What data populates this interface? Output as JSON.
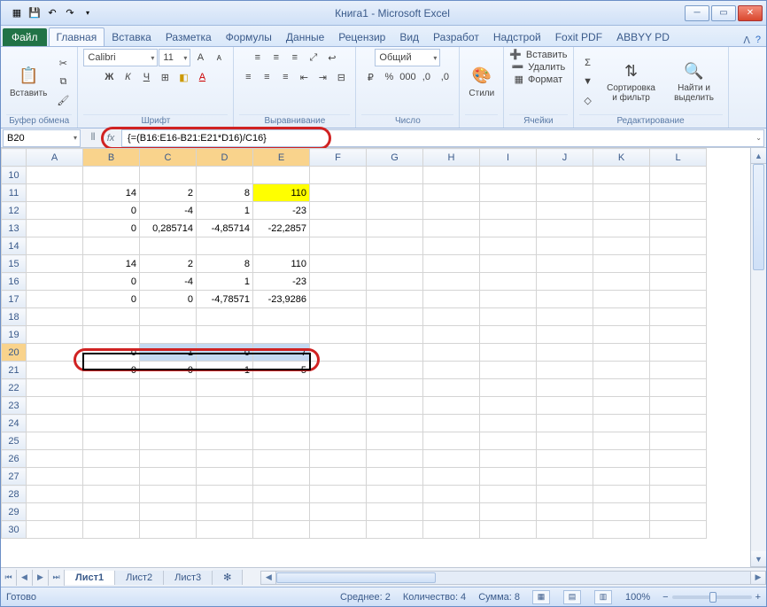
{
  "title": "Книга1 - Microsoft Excel",
  "tabs": {
    "file": "Файл",
    "items": [
      "Главная",
      "Вставка",
      "Разметка",
      "Формулы",
      "Данные",
      "Рецензир",
      "Вид",
      "Разработ",
      "Надстрой",
      "Foxit PDF",
      "ABBYY PD"
    ],
    "active": 0
  },
  "ribbon": {
    "clipboard": {
      "paste": "Вставить",
      "label": "Буфер обмена"
    },
    "font": {
      "name": "Calibri",
      "size": "11",
      "label": "Шрифт"
    },
    "align": {
      "label": "Выравнивание"
    },
    "number": {
      "format": "Общий",
      "label": "Число"
    },
    "styles": {
      "btn": "Стили"
    },
    "cells": {
      "insert": "Вставить",
      "delete": "Удалить",
      "format": "Формат",
      "label": "Ячейки"
    },
    "editing": {
      "sort": "Сортировка и фильтр",
      "find": "Найти и выделить",
      "label": "Редактирование"
    }
  },
  "namebox": "B20",
  "formula": "{=(B16:E16-B21:E21*D16)/C16}",
  "columns": [
    "A",
    "B",
    "C",
    "D",
    "E",
    "F",
    "G",
    "H",
    "I",
    "J",
    "K",
    "L"
  ],
  "rows": [
    {
      "r": 10,
      "c": [
        "",
        "",
        "",
        "",
        "",
        "",
        "",
        "",
        "",
        "",
        "",
        ""
      ]
    },
    {
      "r": 11,
      "c": [
        "",
        "14",
        "2",
        "8",
        "110",
        "",
        "",
        "",
        "",
        "",
        "",
        ""
      ]
    },
    {
      "r": 12,
      "c": [
        "",
        "0",
        "-4",
        "1",
        "-23",
        "",
        "",
        "",
        "",
        "",
        "",
        ""
      ]
    },
    {
      "r": 13,
      "c": [
        "",
        "0",
        "0,285714",
        "-4,85714",
        "-22,2857",
        "",
        "",
        "",
        "",
        "",
        "",
        ""
      ]
    },
    {
      "r": 14,
      "c": [
        "",
        "",
        "",
        "",
        "",
        "",
        "",
        "",
        "",
        "",
        "",
        ""
      ]
    },
    {
      "r": 15,
      "c": [
        "",
        "14",
        "2",
        "8",
        "110",
        "",
        "",
        "",
        "",
        "",
        "",
        ""
      ]
    },
    {
      "r": 16,
      "c": [
        "",
        "0",
        "-4",
        "1",
        "-23",
        "",
        "",
        "",
        "",
        "",
        "",
        ""
      ]
    },
    {
      "r": 17,
      "c": [
        "",
        "0",
        "0",
        "-4,78571",
        "-23,9286",
        "",
        "",
        "",
        "",
        "",
        "",
        ""
      ]
    },
    {
      "r": 18,
      "c": [
        "",
        "",
        "",
        "",
        "",
        "",
        "",
        "",
        "",
        "",
        "",
        ""
      ]
    },
    {
      "r": 19,
      "c": [
        "",
        "",
        "",
        "",
        "",
        "",
        "",
        "",
        "",
        "",
        "",
        ""
      ]
    },
    {
      "r": 20,
      "c": [
        "",
        "0",
        "1",
        "0",
        "7",
        "",
        "",
        "",
        "",
        "",
        "",
        ""
      ]
    },
    {
      "r": 21,
      "c": [
        "",
        "0",
        "0",
        "1",
        "5",
        "",
        "",
        "",
        "",
        "",
        "",
        ""
      ]
    },
    {
      "r": 22,
      "c": [
        "",
        "",
        "",
        "",
        "",
        "",
        "",
        "",
        "",
        "",
        "",
        ""
      ]
    },
    {
      "r": 23,
      "c": [
        "",
        "",
        "",
        "",
        "",
        "",
        "",
        "",
        "",
        "",
        "",
        ""
      ]
    },
    {
      "r": 24,
      "c": [
        "",
        "",
        "",
        "",
        "",
        "",
        "",
        "",
        "",
        "",
        "",
        ""
      ]
    },
    {
      "r": 25,
      "c": [
        "",
        "",
        "",
        "",
        "",
        "",
        "",
        "",
        "",
        "",
        "",
        ""
      ]
    },
    {
      "r": 26,
      "c": [
        "",
        "",
        "",
        "",
        "",
        "",
        "",
        "",
        "",
        "",
        "",
        ""
      ]
    },
    {
      "r": 27,
      "c": [
        "",
        "",
        "",
        "",
        "",
        "",
        "",
        "",
        "",
        "",
        "",
        ""
      ]
    },
    {
      "r": 28,
      "c": [
        "",
        "",
        "",
        "",
        "",
        "",
        "",
        "",
        "",
        "",
        "",
        ""
      ]
    },
    {
      "r": 29,
      "c": [
        "",
        "",
        "",
        "",
        "",
        "",
        "",
        "",
        "",
        "",
        "",
        ""
      ]
    },
    {
      "r": 30,
      "c": [
        "",
        "",
        "",
        "",
        "",
        "",
        "",
        "",
        "",
        "",
        "",
        ""
      ]
    }
  ],
  "sheets": {
    "items": [
      "Лист1",
      "Лист2",
      "Лист3"
    ],
    "active": 0
  },
  "status": {
    "ready": "Готово",
    "avg": "Среднее: 2",
    "count": "Количество: 4",
    "sum": "Сумма: 8",
    "zoom": "100%"
  }
}
